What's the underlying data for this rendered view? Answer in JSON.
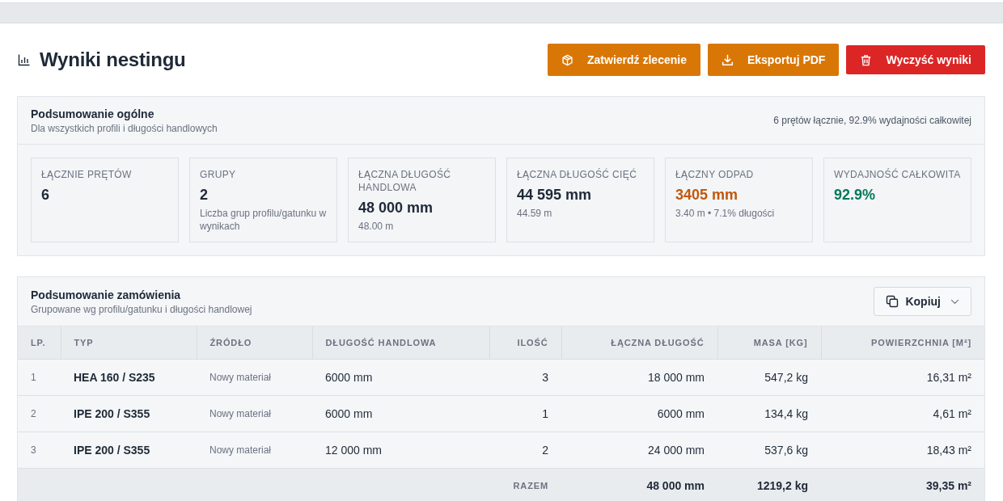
{
  "header": {
    "title": "Wyniki nestingu",
    "buttons": [
      {
        "label": "Zatwierdź zlecenie",
        "kind": "confirm"
      },
      {
        "label": "Eksportuj PDF",
        "kind": "export"
      },
      {
        "label": "Wyczyść wyniki",
        "kind": "clear"
      }
    ]
  },
  "overall_summary": {
    "title": "Podsumowanie ogólne",
    "subtitle": "Dla wszystkich profili i długości handlowych",
    "summary": "6 prętów łącznie, 92.9% wydajności całkowitej",
    "stats": [
      {
        "label": "ŁĄCZNIE PRĘTÓW",
        "value": "6",
        "color": "#1f2937"
      },
      {
        "label": "GRUPY",
        "value": "2",
        "note": "Liczba grup profilu/gatunku w wynikach",
        "color": "#1f2937"
      },
      {
        "label": "ŁĄCZNA DŁUGOŚĆ HANDLOWA",
        "value": "48 000 mm",
        "note": "48.00 m",
        "color": "#1f2937"
      },
      {
        "label": "ŁĄCZNA DŁUGOŚĆ CIĘĆ",
        "value": "44 595 mm",
        "note": "44.59 m",
        "color": "#1f2937"
      },
      {
        "label": "ŁĄCZNY ODPAD",
        "value": "3405 mm",
        "note": "3.40 m • 7.1% długości",
        "color": "#c2570c"
      },
      {
        "label": "WYDAJNOŚĆ CAŁKOWITA",
        "value": "92.9%",
        "color": "#047857"
      }
    ]
  },
  "order_summary": {
    "title": "Podsumowanie zamówienia",
    "subtitle": "Grupowane wg profilu/gatunku i długości handlowej",
    "copy_button": {
      "label": "Kopiuj"
    },
    "table": {
      "columns": [
        "LP.",
        "TYP",
        "ŹRÓDŁO",
        "DŁUGOŚĆ HANDLOWA",
        "ILOŚĆ",
        "ŁĄCZNA DŁUGOŚĆ",
        "MASA [KG]",
        "POWIERZCHNIA [M²]"
      ],
      "rows": [
        [
          "1",
          "HEA 160 / S235",
          "Nowy materiał",
          "6000 mm",
          "3",
          "18 000 mm",
          "547,2 kg",
          "16,31 m²"
        ],
        [
          "2",
          "IPE 200 / S355",
          "Nowy materiał",
          "6000 mm",
          "1",
          "6000 mm",
          "134,4 kg",
          "4,61 m²"
        ],
        [
          "3",
          "IPE 200 / S355",
          "Nowy materiał",
          "12 000 mm",
          "2",
          "24 000 mm",
          "537,6 kg",
          "18,43 m²"
        ]
      ],
      "totals": {
        "label": "RAZEM",
        "total_length": "48 000 mm",
        "mass": "1219,2 kg",
        "area": "39,35 m²"
      }
    }
  }
}
